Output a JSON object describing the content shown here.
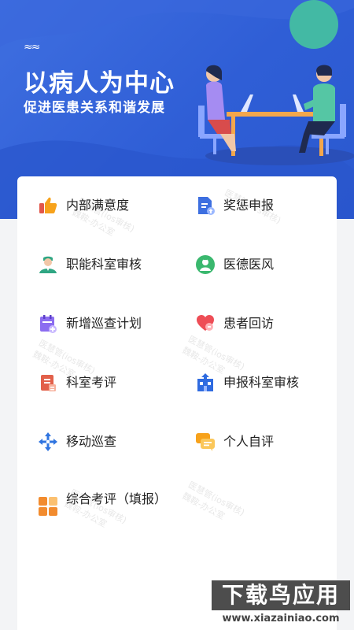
{
  "hero": {
    "title": "以病人为中心",
    "subtitle": "促进医患关系和谐发展"
  },
  "menu": [
    {
      "label": "内部满意度",
      "icon": "thumbs-up-icon"
    },
    {
      "label": "奖惩申报",
      "icon": "document-upload-icon"
    },
    {
      "label": "职能科室审核",
      "icon": "doctor-icon"
    },
    {
      "label": "医德医风",
      "icon": "nurse-badge-icon"
    },
    {
      "label": "新增巡查计划",
      "icon": "calendar-add-icon"
    },
    {
      "label": "患者回访",
      "icon": "heart-chat-icon"
    },
    {
      "label": "科室考评",
      "icon": "clipboard-report-icon"
    },
    {
      "label": "申报科室审核",
      "icon": "building-upload-icon"
    },
    {
      "label": "移动巡查",
      "icon": "move-arrows-icon"
    },
    {
      "label": "个人自评",
      "icon": "chat-bubbles-icon"
    },
    {
      "label": "综合考评（填报）",
      "icon": "grid-blocks-icon"
    }
  ],
  "watermark": {
    "line1": "医慧管(ios审核)",
    "line2": "魏鞍-办公室"
  },
  "badge": {
    "top": "下载鸟应用",
    "bottom": "www.xiazainiao.com"
  }
}
